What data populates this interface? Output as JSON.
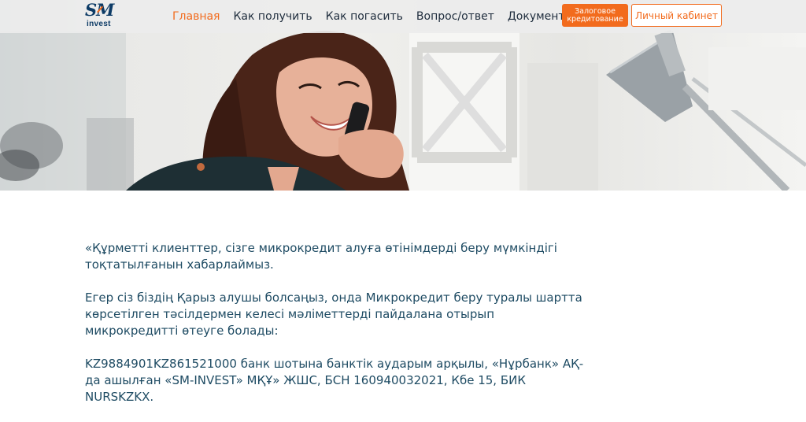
{
  "logo": {
    "brand_sm": "SM",
    "brand_invest": "invest"
  },
  "nav": {
    "items": [
      {
        "label": "Главная",
        "active": true
      },
      {
        "label": "Как получить",
        "active": false
      },
      {
        "label": "Как погасить",
        "active": false
      },
      {
        "label": "Вопрос/ответ",
        "active": false
      },
      {
        "label": "Документы",
        "active": false
      }
    ],
    "pledge_button": {
      "line1": "Залоговое",
      "line2": "кредитование"
    },
    "cabinet_button": "Личный кабинет"
  },
  "colors": {
    "accent": "#f26b1d",
    "text": "#1e4b63",
    "logo": "#0d3b66"
  },
  "content": {
    "paragraphs": [
      "«Құрметті клиенттер, сізге микрокредит алуға өтінімдерді беру мүмкіндігі тоқтатылғанын хабарлаймыз.",
      "Егер сіз біздің Қарыз алушы болсаңыз, онда Микрокредит беру туралы шартта көрсетілген тәсілдермен келесі мәліметтерді пайдалана отырып микрокредитті өтеуге болады:",
      "KZ9884901KZ861521000 банк шотына банктік аударым арқылы, «Нұрбанк» АҚ-да ашылған «SM-INVEST» МҚҰ» ЖШС, БСН 160940032021, Кбе 15, БИК NURSKZKX."
    ]
  }
}
